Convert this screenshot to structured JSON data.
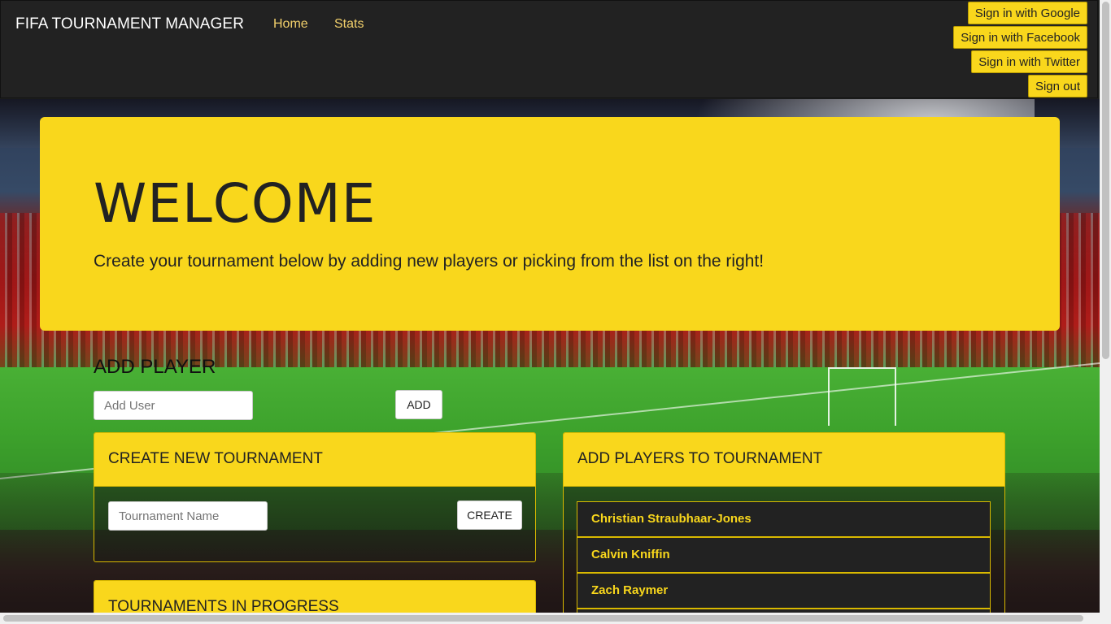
{
  "navbar": {
    "brand": "FIFA TOURNAMENT MANAGER",
    "links": {
      "home": "Home",
      "stats": "Stats"
    },
    "auth": {
      "google": "Sign in with Google",
      "facebook": "Sign in with Facebook",
      "twitter": "Sign in with Twitter",
      "signout": "Sign out"
    }
  },
  "jumbotron": {
    "title": "WELCOME",
    "subtitle": "Create your tournament below by adding new players or picking from the list on the right!"
  },
  "add_player": {
    "title": "ADD PLAYER",
    "input_placeholder": "Add User",
    "button": "ADD"
  },
  "create_tournament": {
    "title": "CREATE NEW TOURNAMENT",
    "input_placeholder": "Tournament Name",
    "button": "CREATE"
  },
  "add_players_panel": {
    "title": "ADD PLAYERS TO TOURNAMENT",
    "players": [
      "Christian Straubhaar-Jones",
      "Calvin Kniffin",
      "Zach Raymer"
    ]
  },
  "in_progress": {
    "title": "TOURNAMENTS IN PROGRESS"
  },
  "colors": {
    "accent": "#f9d71c",
    "navbar": "#222222",
    "nav_link": "#f2d06b"
  }
}
